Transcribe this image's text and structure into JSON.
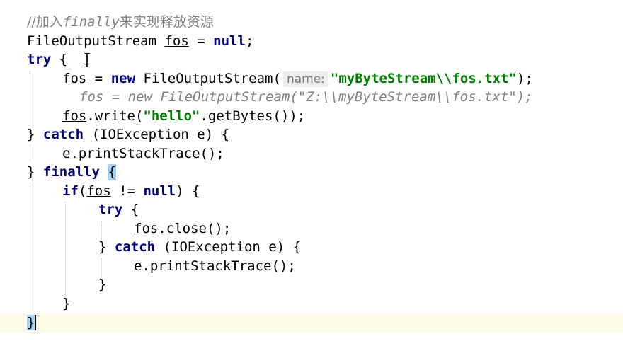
{
  "code": {
    "comment_prefix": "//加入",
    "comment_keyword": "finally",
    "comment_suffix": "来实现释放资源",
    "line1_type": "FileOutputStream",
    "var_name": "fos",
    "op_assign": "=",
    "null_kw": "null",
    "try_kw": "try",
    "catch_kw": "catch",
    "finally_kw": "finally",
    "if_kw": "if",
    "new_kw": "new",
    "ctor": "FileOutputStream(",
    "param_hint": "name:",
    "path_string": "\"myByteStream\\\\fos.txt\"",
    "line_end_paren": ");",
    "commented_line": "fos = new FileOutputStream(\"Z:\\\\myByteStream\\\\fos.txt\");",
    "write_call": ".write(",
    "hello_string": "\"hello\"",
    "getbytes_call": ".getBytes());",
    "exception_param": "(IOException e) {",
    "print_stack": "e.printStackTrace();",
    "not_equal": "!=",
    "close_call": ".close();",
    "open_brace": "{",
    "close_brace": "}"
  }
}
